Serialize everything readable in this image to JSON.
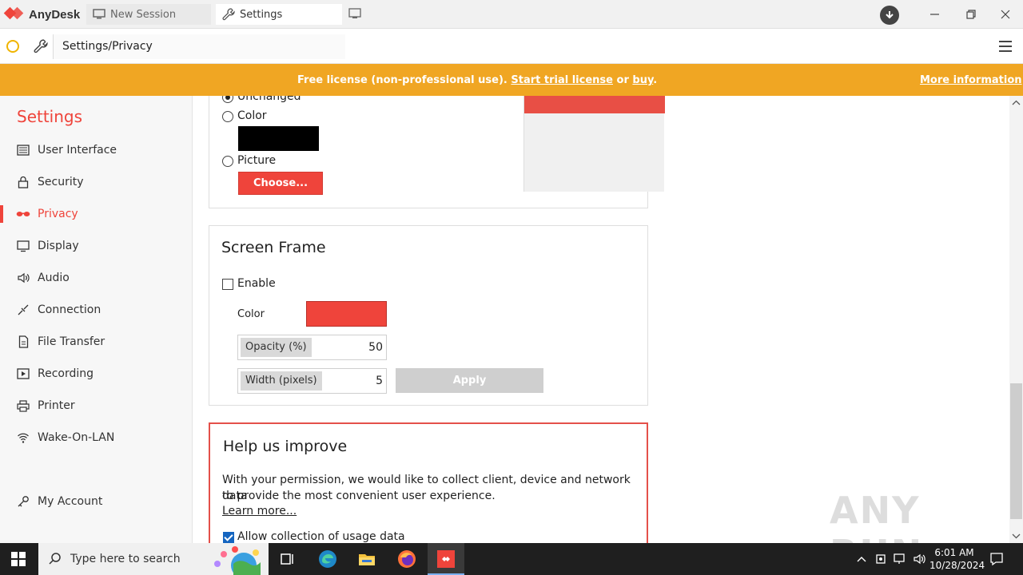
{
  "app": {
    "name": "AnyDesk",
    "tabs": [
      {
        "label": "New Session"
      },
      {
        "label": "Settings"
      }
    ],
    "address": "Settings/Privacy"
  },
  "banner": {
    "prefix": "Free license (non-professional use). ",
    "trial_link": "Start trial license",
    "or": " or ",
    "buy_link": "buy",
    "suffix": ".",
    "more": "More information"
  },
  "sidebar": {
    "title": "Settings",
    "items": [
      {
        "label": "User Interface",
        "icon": "user-interface-icon"
      },
      {
        "label": "Security",
        "icon": "lock-icon"
      },
      {
        "label": "Privacy",
        "icon": "glasses-icon",
        "active": true
      },
      {
        "label": "Display",
        "icon": "monitor-icon"
      },
      {
        "label": "Audio",
        "icon": "speaker-icon"
      },
      {
        "label": "Connection",
        "icon": "connection-icon"
      },
      {
        "label": "File Transfer",
        "icon": "file-icon"
      },
      {
        "label": "Recording",
        "icon": "recording-icon"
      },
      {
        "label": "Printer",
        "icon": "printer-icon"
      },
      {
        "label": "Wake-On-LAN",
        "icon": "wifi-icon"
      }
    ],
    "account": "My Account"
  },
  "background": {
    "unchanged": "Unchanged",
    "color": "Color",
    "picture": "Picture",
    "choose": "Choose..."
  },
  "screen_frame": {
    "title": "Screen Frame",
    "enable": "Enable",
    "color_label": "Color",
    "opacity_label": "Opacity (%)",
    "opacity_value": "50",
    "width_label": "Width (pixels)",
    "width_value": "5",
    "apply": "Apply",
    "swatch_color": "#ef443b"
  },
  "help": {
    "title": "Help us improve",
    "line1": "With your permission, we would like to collect client, device and network data",
    "line2": "to provide the most convenient user experience.",
    "learn_more": "Learn more...",
    "allow": "Allow collection of usage data"
  },
  "watermark": "ANY RUN",
  "taskbar": {
    "search_placeholder": "Type here to search",
    "time": "6:01 AM",
    "date": "10/28/2024"
  }
}
